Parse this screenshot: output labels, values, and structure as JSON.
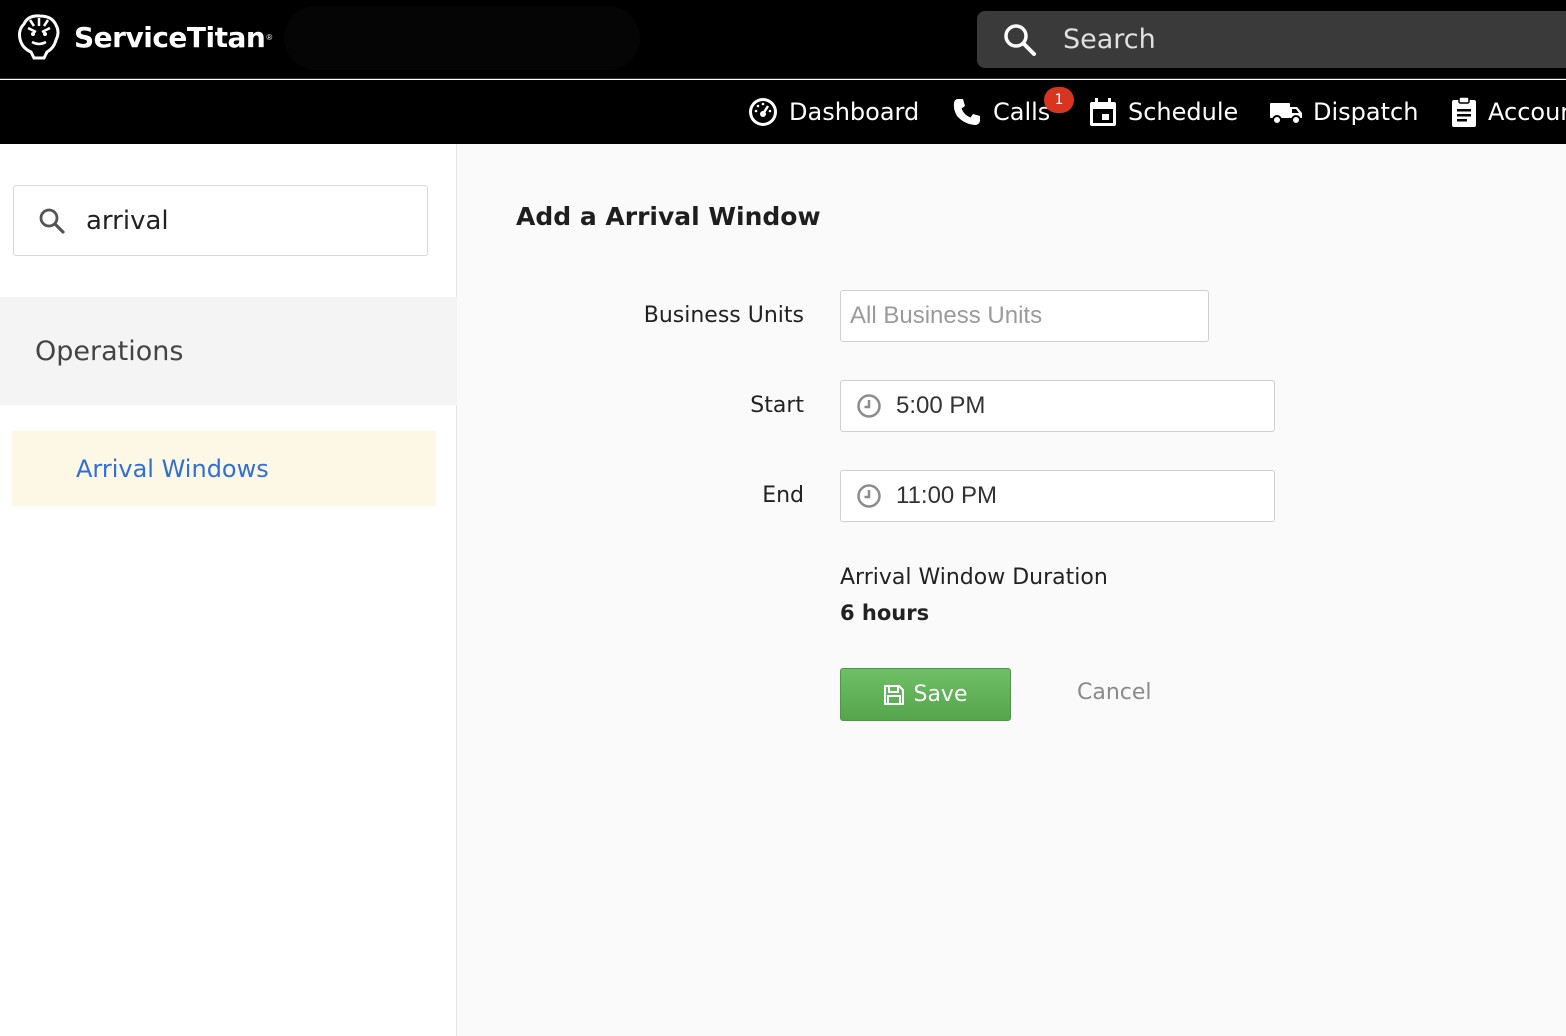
{
  "app": {
    "brand": "ServiceTitan",
    "brand_mark": "®"
  },
  "header": {
    "search_placeholder": "Search"
  },
  "nav": {
    "items": [
      {
        "label": "Dashboard",
        "icon": "dashboard-gauge-icon"
      },
      {
        "label": "Calls",
        "icon": "phone-icon",
        "badge": "1"
      },
      {
        "label": "Schedule",
        "icon": "calendar-icon"
      },
      {
        "label": "Dispatch",
        "icon": "truck-icon"
      },
      {
        "label": "Accoun",
        "icon": "clipboard-icon"
      }
    ]
  },
  "sidebar": {
    "search_value": "arrival",
    "section_title": "Operations",
    "active_link": "Arrival Windows"
  },
  "form": {
    "title": "Add a Arrival Window",
    "business_units_label": "Business Units",
    "business_units_placeholder": "All Business Units",
    "start_label": "Start",
    "start_value": "5:00 PM",
    "end_label": "End",
    "end_value": "11:00 PM",
    "duration_label": "Arrival Window Duration",
    "duration_value": "6 hours",
    "save_label": "Save",
    "cancel_label": "Cancel"
  },
  "colors": {
    "topbar": "#000000",
    "save_green": "#5cb152",
    "link_blue": "#2f6fd6",
    "badge_red": "#d9341f",
    "active_link_bg": "#fdf7e5"
  }
}
